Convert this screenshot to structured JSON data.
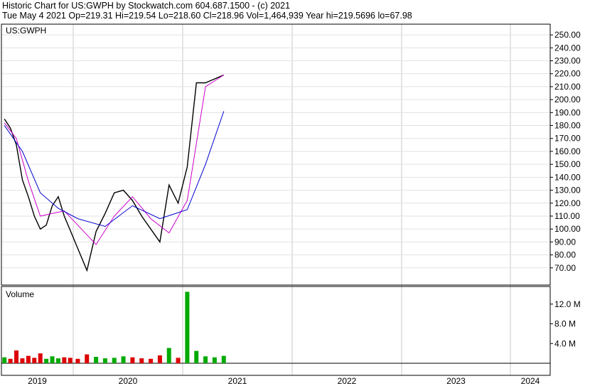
{
  "header": {
    "line1": "Historic Chart for US:GWPH by Stockwatch.com 604.687.1500 - (c) 2021",
    "line2": "Tue May  4 2021  Op=219.31  Hi=219.54  Lo=218.60  Cl=218.96  Vol=1,464,939  Year hi=219.5696  lo=67.98"
  },
  "chart_data": [
    {
      "type": "line",
      "title": "US:GWPH",
      "ylim": [
        60,
        255
      ],
      "y_ticks": [
        "250.00",
        "240.00",
        "230.00",
        "220.00",
        "210.00",
        "200.00",
        "190.00",
        "180.00",
        "170.00",
        "160.00",
        "150.00",
        "140.00",
        "130.00",
        "120.00",
        "110.00",
        "100.00",
        "90.00",
        "80.00",
        "70.00"
      ],
      "x_ticks": [
        "2019",
        "2020",
        "2021",
        "2022",
        "2023",
        "2024"
      ],
      "colors": {
        "price": "#000000",
        "ma_short": "#cc00cc",
        "ma_long": "#0000cc"
      },
      "series": [
        {
          "role": "price",
          "x": [
            "2019-01",
            "2019-02",
            "2019-03",
            "2019-04",
            "2019-05",
            "2019-06",
            "2019-07",
            "2019-08",
            "2019-09",
            "2019-10",
            "2019-11",
            "2019-12",
            "2020-01",
            "2020-02",
            "2020-03",
            "2020-04",
            "2020-05",
            "2020-06",
            "2020-07",
            "2020-08",
            "2020-09",
            "2020-10",
            "2020-11",
            "2020-12",
            "2021-01",
            "2021-02",
            "2021-03",
            "2021-04",
            "2021-05"
          ],
          "values": [
            185,
            178,
            165,
            138,
            125,
            110,
            100,
            103,
            118,
            125,
            110,
            99,
            85,
            68,
            98,
            112,
            128,
            130,
            122,
            110,
            100,
            90,
            134,
            120,
            148,
            213,
            213,
            216,
            219
          ]
        },
        {
          "role": "ma_short",
          "x": [
            "2019-01",
            "2019-03",
            "2019-05",
            "2019-07",
            "2019-09",
            "2019-11",
            "2020-01",
            "2020-03",
            "2020-05",
            "2020-07",
            "2020-09",
            "2020-11",
            "2021-01",
            "2021-03",
            "2021-05"
          ],
          "values": [
            182,
            170,
            137,
            110,
            112,
            114,
            103,
            88,
            110,
            125,
            108,
            97,
            122,
            210,
            219
          ]
        },
        {
          "role": "ma_long",
          "x": [
            "2019-01",
            "2019-04",
            "2019-07",
            "2019-10",
            "2020-01",
            "2020-04",
            "2020-07",
            "2020-10",
            "2021-01",
            "2021-03",
            "2021-05"
          ],
          "values": [
            180,
            160,
            128,
            116,
            108,
            102,
            118,
            108,
            115,
            150,
            191
          ]
        }
      ]
    },
    {
      "type": "bar",
      "title": "Volume",
      "ylim": [
        0,
        15
      ],
      "y_unit": "M",
      "y_ticks": [
        "12.0 M",
        "8.0 M",
        "4.0 M"
      ],
      "colors": {
        "up": "#00aa00",
        "down": "#dd0000"
      },
      "x": [
        "2019-01",
        "2019-02",
        "2019-03",
        "2019-04",
        "2019-05",
        "2019-06",
        "2019-07",
        "2019-08",
        "2019-09",
        "2019-10",
        "2019-11",
        "2019-12",
        "2020-01",
        "2020-02",
        "2020-03",
        "2020-04",
        "2020-05",
        "2020-06",
        "2020-07",
        "2020-08",
        "2020-09",
        "2020-10",
        "2020-11",
        "2020-12",
        "2021-01",
        "2021-02",
        "2021-03",
        "2021-04",
        "2021-05"
      ],
      "values": [
        1.2,
        0.9,
        2.6,
        1.0,
        1.5,
        1.1,
        2.0,
        0.9,
        1.4,
        1.0,
        1.2,
        1.1,
        0.9,
        1.8,
        1.3,
        1.0,
        1.1,
        1.4,
        1.2,
        1.0,
        0.9,
        1.6,
        3.1,
        1.1,
        14.5,
        2.5,
        1.4,
        1.2,
        1.5
      ]
    }
  ]
}
